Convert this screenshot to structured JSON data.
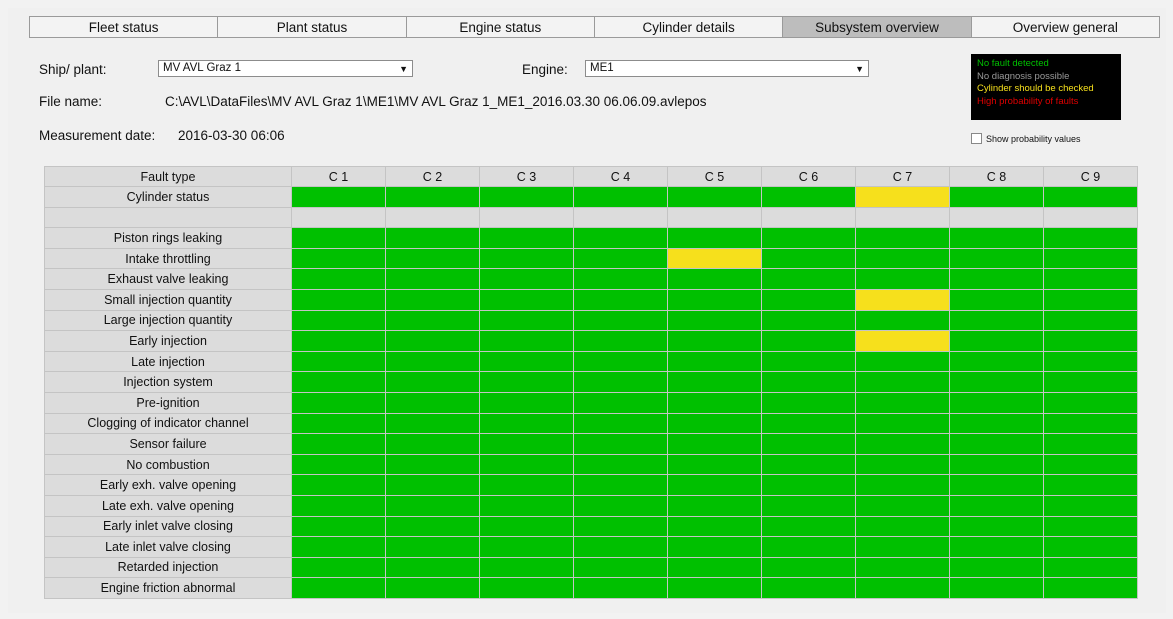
{
  "tabs": [
    {
      "label": "Fleet status",
      "active": false
    },
    {
      "label": "Plant status",
      "active": false
    },
    {
      "label": "Engine status",
      "active": false
    },
    {
      "label": "Cylinder details",
      "active": false
    },
    {
      "label": "Subsystem overview",
      "active": true
    },
    {
      "label": "Overview general",
      "active": false
    }
  ],
  "header": {
    "ship_label": "Ship/ plant:",
    "ship_value": "MV AVL Graz 1",
    "engine_label": "Engine:",
    "engine_value": "ME1",
    "file_label": "File name:",
    "file_value": "C:\\AVL\\DataFiles\\MV AVL Graz 1\\ME1\\MV AVL Graz 1_ME1_2016.03.30 06.06.09.avlepos",
    "date_label": "Measurement date:",
    "date_value": "2016-03-30 06:06",
    "show_probability_label": "Show probability values",
    "show_probability_checked": false
  },
  "legend": [
    {
      "label": "No fault detected",
      "color": "#00c000"
    },
    {
      "label": "No diagnosis possible",
      "color": "#9a9a9a"
    },
    {
      "label": "Cylinder should be checked",
      "color": "#f6e01c"
    },
    {
      "label": "High probability of faults",
      "color": "#e00000"
    }
  ],
  "colors": {
    "green": "#00c000",
    "yellow": "#f6e01c",
    "grey": "#dcdcdc"
  },
  "grid": {
    "header_label": "Fault type",
    "columns": [
      "C 1",
      "C 2",
      "C 3",
      "C 4",
      "C 5",
      "C 6",
      "C 7",
      "C 8",
      "C 9"
    ],
    "rows": [
      {
        "label": "Cylinder status",
        "cells": [
          "green",
          "green",
          "green",
          "green",
          "green",
          "green",
          "yellow",
          "green",
          "green"
        ]
      },
      {
        "label": "",
        "cells": [
          "grey",
          "grey",
          "grey",
          "grey",
          "grey",
          "grey",
          "grey",
          "grey",
          "grey"
        ]
      },
      {
        "label": "Piston rings leaking",
        "cells": [
          "green",
          "green",
          "green",
          "green",
          "green",
          "green",
          "green",
          "green",
          "green"
        ]
      },
      {
        "label": "Intake throttling",
        "cells": [
          "green",
          "green",
          "green",
          "green",
          "yellow",
          "green",
          "green",
          "green",
          "green"
        ]
      },
      {
        "label": "Exhaust valve leaking",
        "cells": [
          "green",
          "green",
          "green",
          "green",
          "green",
          "green",
          "green",
          "green",
          "green"
        ]
      },
      {
        "label": "Small injection quantity",
        "cells": [
          "green",
          "green",
          "green",
          "green",
          "green",
          "green",
          "yellow",
          "green",
          "green"
        ]
      },
      {
        "label": "Large injection quantity",
        "cells": [
          "green",
          "green",
          "green",
          "green",
          "green",
          "green",
          "green",
          "green",
          "green"
        ]
      },
      {
        "label": "Early injection",
        "cells": [
          "green",
          "green",
          "green",
          "green",
          "green",
          "green",
          "yellow",
          "green",
          "green"
        ]
      },
      {
        "label": "Late injection",
        "cells": [
          "green",
          "green",
          "green",
          "green",
          "green",
          "green",
          "green",
          "green",
          "green"
        ]
      },
      {
        "label": "Injection system",
        "cells": [
          "green",
          "green",
          "green",
          "green",
          "green",
          "green",
          "green",
          "green",
          "green"
        ]
      },
      {
        "label": "Pre-ignition",
        "cells": [
          "green",
          "green",
          "green",
          "green",
          "green",
          "green",
          "green",
          "green",
          "green"
        ]
      },
      {
        "label": "Clogging of indicator channel",
        "cells": [
          "green",
          "green",
          "green",
          "green",
          "green",
          "green",
          "green",
          "green",
          "green"
        ]
      },
      {
        "label": "Sensor failure",
        "cells": [
          "green",
          "green",
          "green",
          "green",
          "green",
          "green",
          "green",
          "green",
          "green"
        ]
      },
      {
        "label": "No combustion",
        "cells": [
          "green",
          "green",
          "green",
          "green",
          "green",
          "green",
          "green",
          "green",
          "green"
        ]
      },
      {
        "label": "Early exh. valve opening",
        "cells": [
          "green",
          "green",
          "green",
          "green",
          "green",
          "green",
          "green",
          "green",
          "green"
        ]
      },
      {
        "label": "Late exh. valve opening",
        "cells": [
          "green",
          "green",
          "green",
          "green",
          "green",
          "green",
          "green",
          "green",
          "green"
        ]
      },
      {
        "label": "Early inlet valve closing",
        "cells": [
          "green",
          "green",
          "green",
          "green",
          "green",
          "green",
          "green",
          "green",
          "green"
        ]
      },
      {
        "label": "Late inlet valve closing",
        "cells": [
          "green",
          "green",
          "green",
          "green",
          "green",
          "green",
          "green",
          "green",
          "green"
        ]
      },
      {
        "label": "Retarded injection",
        "cells": [
          "green",
          "green",
          "green",
          "green",
          "green",
          "green",
          "green",
          "green",
          "green"
        ]
      },
      {
        "label": "Engine friction abnormal",
        "cells": [
          "green",
          "green",
          "green",
          "green",
          "green",
          "green",
          "green",
          "green",
          "green"
        ]
      }
    ]
  }
}
